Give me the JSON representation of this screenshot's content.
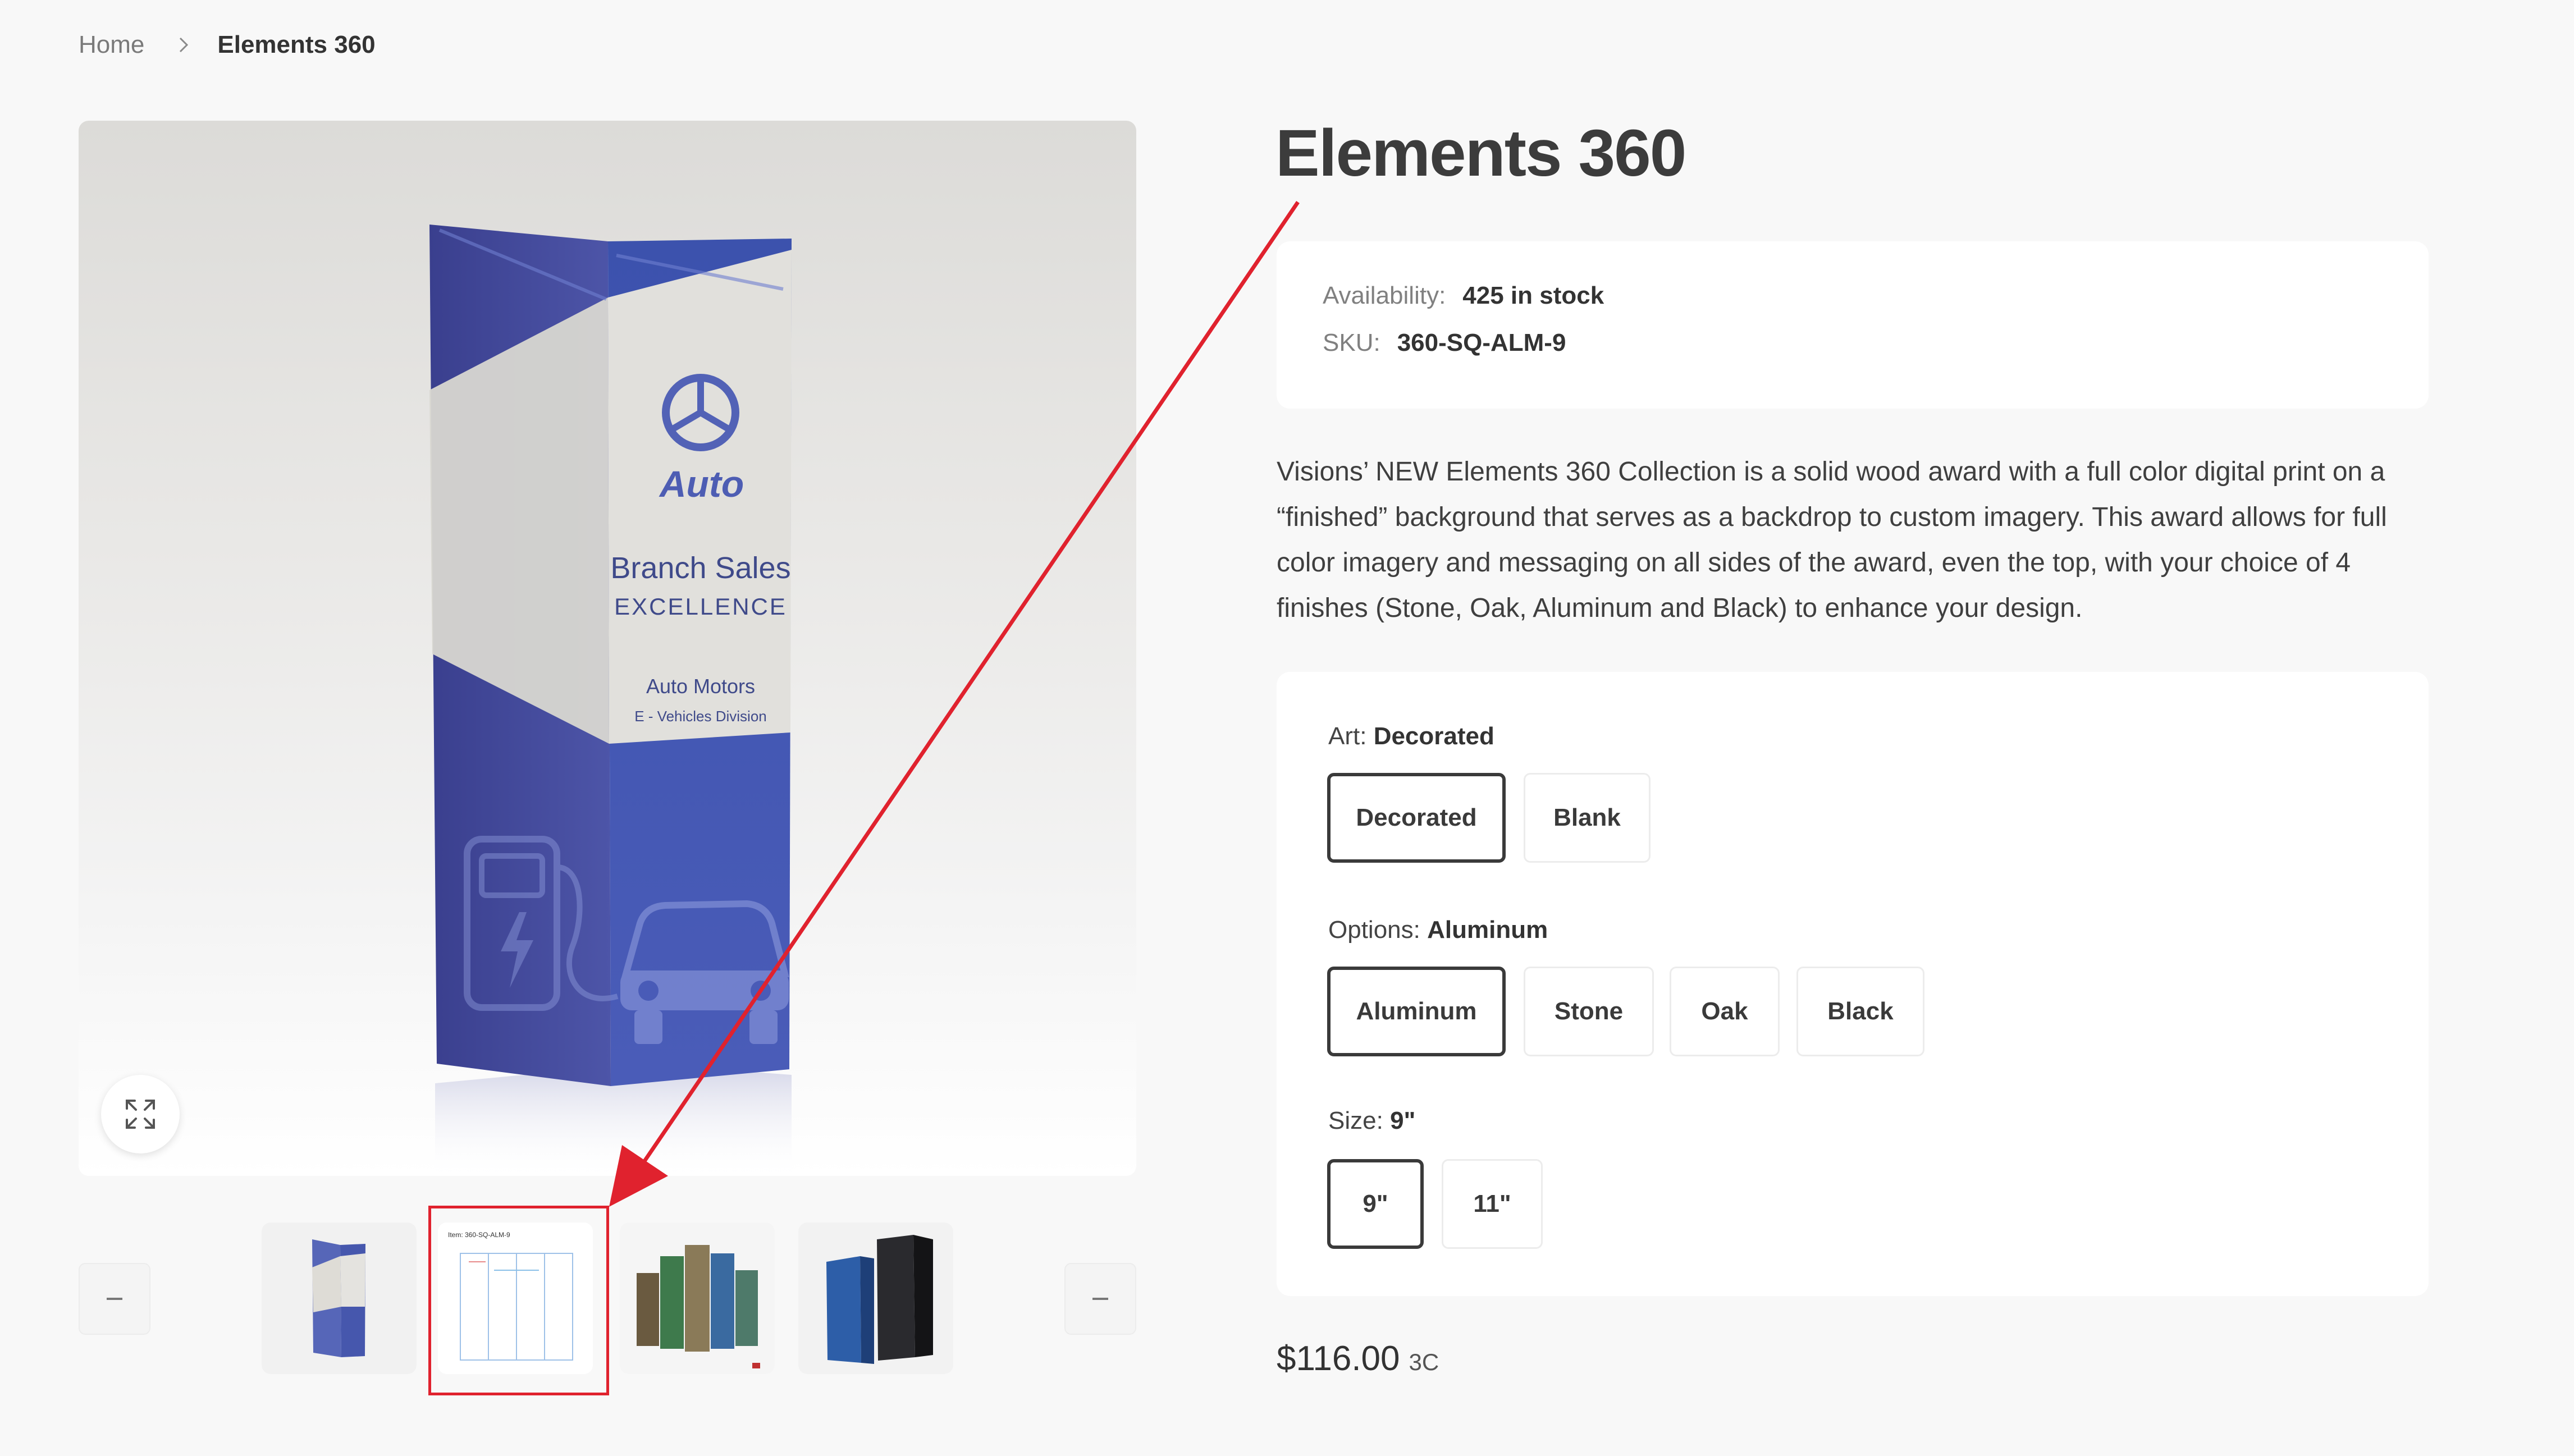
{
  "breadcrumb": {
    "home": "Home",
    "current": "Elements 360"
  },
  "product": {
    "title": "Elements 360",
    "availability_label": "Availability:",
    "availability_value": "425 in stock",
    "sku_label": "SKU:",
    "sku_value": "360-SQ-ALM-9",
    "description": "Visions’ NEW Elements 360 Collection is a solid wood award with a full color digital print on a “finished” background that serves as a backdrop to custom imagery. This award allows for full color imagery and messaging on all sides of the award, even the top, with your choice of 4 finishes (Stone, Oak, Aluminum and Black) to enhance your design.",
    "price": "$116.00",
    "price_code": "3C"
  },
  "award_image": {
    "logo_text": "Auto",
    "line1": "Branch Sales",
    "line2": "EXCELLENCE",
    "line3": "Auto Motors",
    "line4": "E - Vehicles Division"
  },
  "thumb_doc": {
    "header": "Item: 360-SQ-ALM-9"
  },
  "options": {
    "art": {
      "label": "Art:",
      "selected": "Decorated",
      "choices": [
        "Decorated",
        "Blank"
      ]
    },
    "finish": {
      "label": "Options:",
      "selected": "Aluminum",
      "choices": [
        "Aluminum",
        "Stone",
        "Oak",
        "Black"
      ]
    },
    "size": {
      "label": "Size:",
      "selected": "9\"",
      "choices": [
        "9\"",
        "11\""
      ]
    }
  },
  "gallery": {
    "prev_icon": "minus-icon",
    "next_icon": "minus-icon",
    "expand_icon": "expand-icon",
    "thumbnails": [
      "award-blue-angle",
      "template-sheet",
      "award-collection",
      "award-black-blue"
    ],
    "highlighted_thumbnail": 1
  },
  "annotation": {
    "color": "#e0222e"
  },
  "colors": {
    "award_blue": "#4a56b0",
    "award_silver": "#d9d9d4",
    "selected_border": "#3a3a3a"
  }
}
